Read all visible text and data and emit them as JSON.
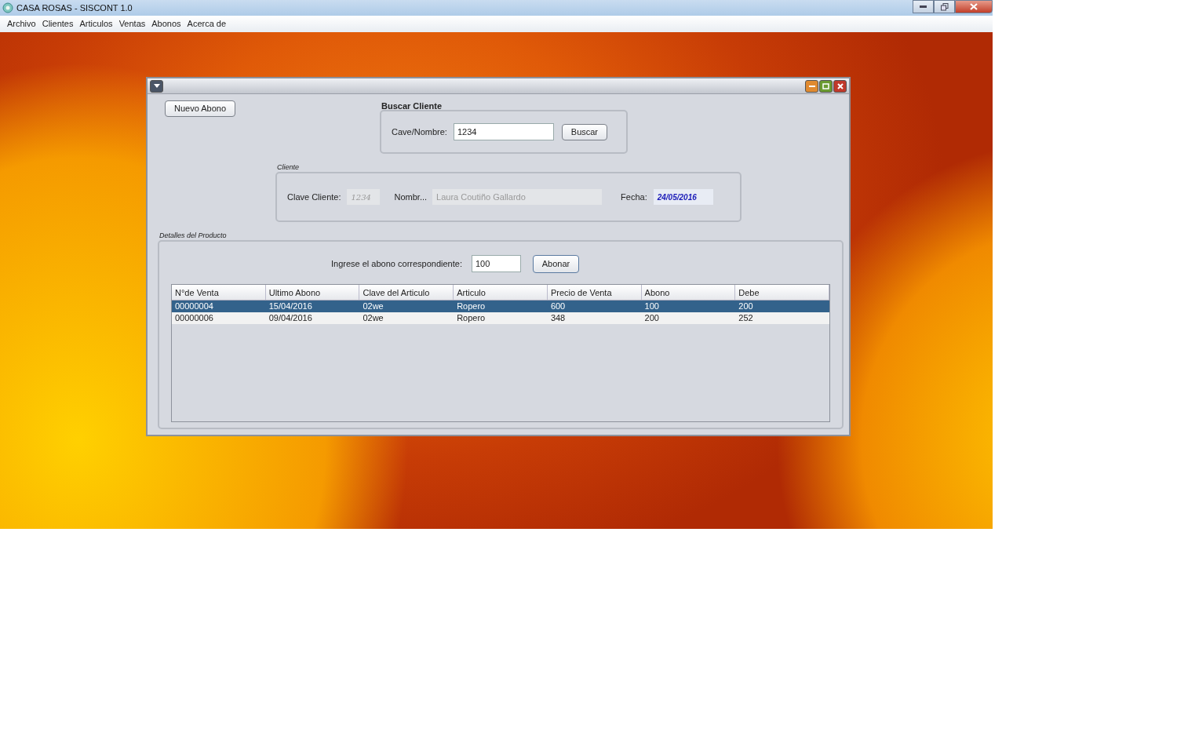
{
  "window": {
    "title": "CASA ROSAS - SISCONT 1.0"
  },
  "menu": [
    "Archivo",
    "Clientes",
    "Articulos",
    "Ventas",
    "Abonos",
    "Acerca de"
  ],
  "frame": {
    "new_button": "Nuevo Abono",
    "search": {
      "title": "Buscar Cliente",
      "label": "Cave/Nombre:",
      "value": "1234",
      "button": "Buscar"
    },
    "client": {
      "title": "Cliente",
      "key_label": "Clave Cliente:",
      "key_value": "1234",
      "name_label": "Nombr...",
      "name_value": "Laura Coutiño Gallardo",
      "date_label": "Fecha:",
      "date_value": "24/05/2016"
    },
    "details": {
      "title": "Detalles del Producto",
      "amount_label": "Ingrese el abono correspondiente:",
      "amount_value": "100",
      "button": "Abonar",
      "table": {
        "columns": [
          "N°de Venta",
          "Ultimo Abono",
          "Clave del Articulo",
          "Articulo",
          "Precio de Venta",
          "Abono",
          "Debe"
        ],
        "rows": [
          {
            "cells": [
              "00000004",
              "15/04/2016",
              "02we",
              "Ropero",
              "600",
              "100",
              "200"
            ],
            "selected": true
          },
          {
            "cells": [
              "00000006",
              "09/04/2016",
              "02we",
              "Ropero",
              "348",
              "200",
              "252"
            ],
            "selected": false
          }
        ]
      }
    }
  }
}
